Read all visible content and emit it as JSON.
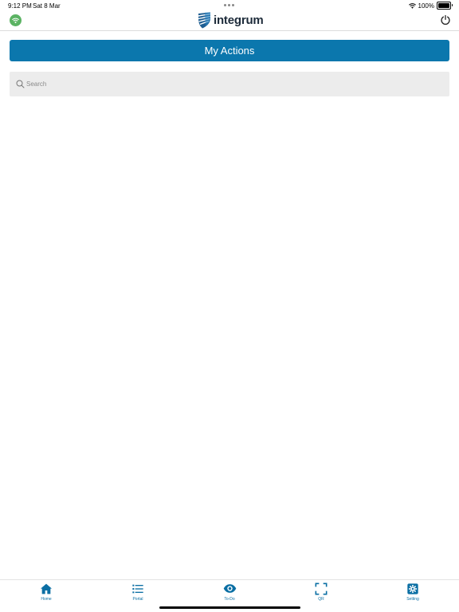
{
  "status_bar": {
    "time": "9:12 PM",
    "date": "Sat 8 Mar",
    "battery": "100%",
    "icons": [
      "wifi-icon",
      "battery-icon"
    ]
  },
  "header": {
    "logo_text": "integrum",
    "left_icon": "wifi-icon",
    "right_icon": "power-icon",
    "colors": {
      "wifi_badge": "#5bb363",
      "logo_text": "#1d2b3a"
    }
  },
  "page": {
    "title": "My Actions",
    "title_bg": "#0b77ad"
  },
  "search": {
    "placeholder": "Search",
    "value": "",
    "icon": "search-icon"
  },
  "tabs": [
    {
      "label": "Home",
      "icon": "home-icon"
    },
    {
      "label": "Portal",
      "icon": "list-icon"
    },
    {
      "label": "To-Do",
      "icon": "eye-icon"
    },
    {
      "label": "QR",
      "icon": "qr-scan-icon"
    },
    {
      "label": "Setting",
      "icon": "gear-icon"
    }
  ],
  "accent_color": "#0b6fa4"
}
